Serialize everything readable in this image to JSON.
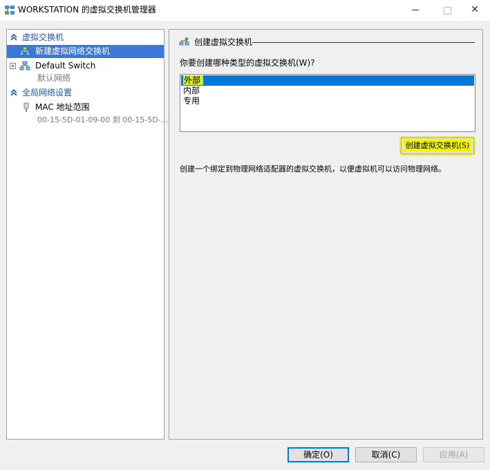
{
  "window": {
    "title": "WORKSTATION 的虚拟交换机管理器",
    "icon": "virtual-switch-manager-icon"
  },
  "left_pane": {
    "sections": [
      {
        "header": "虚拟交换机",
        "items": [
          {
            "label": "新建虚拟网络交换机",
            "selected": true,
            "icon": "new-network-switch-icon"
          },
          {
            "label": "Default Switch",
            "sub": "默认网络",
            "icon": "network-switch-icon"
          }
        ]
      },
      {
        "header": "全局网络设置",
        "items": [
          {
            "label": "MAC 地址范围",
            "sub": "00-15-5D-01-09-00 到 00-15-5D-...",
            "icon": "mac-address-icon"
          }
        ]
      }
    ]
  },
  "right_pane": {
    "group_title": "创建虚拟交换机",
    "question": "你要创建哪种类型的虚拟交换机(W)?",
    "switch_types": [
      "外部",
      "内部",
      "专用"
    ],
    "selected_type": "外部",
    "create_button": "创建虚拟交换机(S)",
    "description": "创建一个绑定到物理网络适配器的虚拟交换机，以便虚拟机可以访问物理网络。"
  },
  "footer": {
    "ok": "确定(O)",
    "cancel": "取消(C)",
    "apply": "应用(A)"
  },
  "colors": {
    "selection": "#3c78d8",
    "list_selection": "#0078d7",
    "highlight": "#eef300",
    "section_header": "#1d56a6"
  }
}
